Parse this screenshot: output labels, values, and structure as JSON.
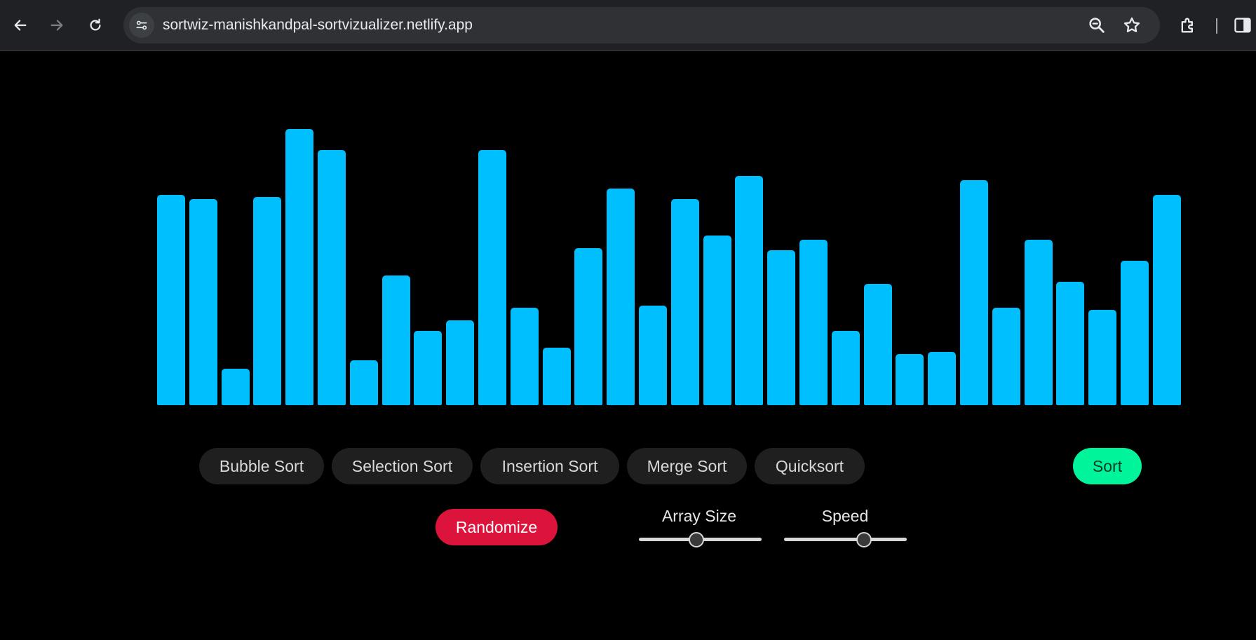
{
  "browser": {
    "url": "sortwiz-manishkandpal-sortvizualizer.netlify.app",
    "icons": [
      "back-arrow-icon",
      "forward-arrow-icon",
      "reload-icon",
      "site-info-icon",
      "zoom-icon",
      "star-icon",
      "extensions-icon",
      "side-panel-icon"
    ]
  },
  "visualizer": {
    "bar_color": "#00bfff",
    "array_values": [
      99,
      97,
      17,
      98,
      130,
      120,
      21,
      61,
      35,
      40,
      120,
      46,
      27,
      74,
      102,
      47,
      97,
      80,
      108,
      73,
      78,
      35,
      57,
      24,
      25,
      106,
      46,
      78,
      58,
      45,
      68,
      99
    ]
  },
  "algorithms": {
    "bubble": "Bubble Sort",
    "selection": "Selection Sort",
    "insertion": "Insertion Sort",
    "merge": "Merge Sort",
    "quick": "Quicksort"
  },
  "controls": {
    "sort_label": "Sort",
    "sort_color": "#00f59a",
    "randomize_label": "Randomize",
    "randomize_color": "#dc143c",
    "array_size_label": "Array Size",
    "array_size_level": 0.47,
    "speed_label": "Speed",
    "speed_level": 0.65
  }
}
